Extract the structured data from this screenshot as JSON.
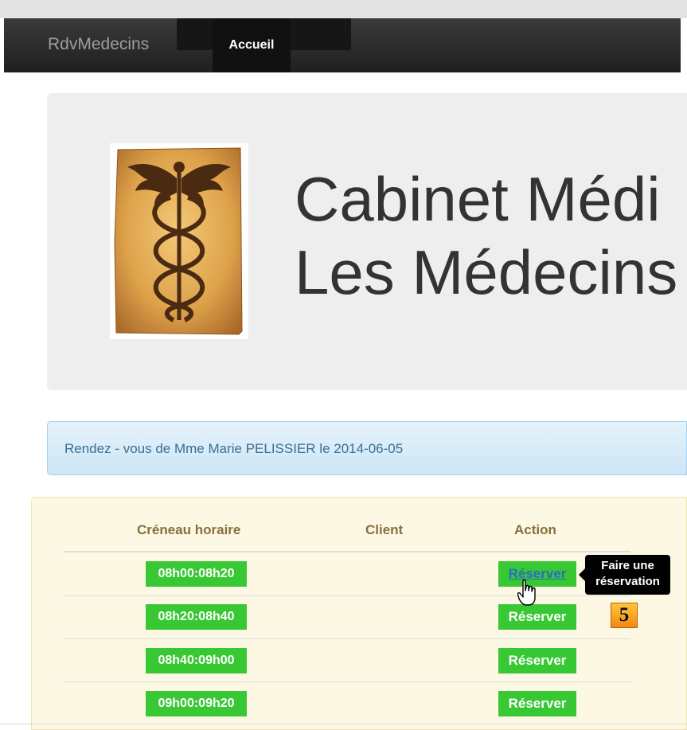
{
  "navbar": {
    "brand": "RdvMedecins",
    "items": [
      {
        "label": "Accueil",
        "active": true
      }
    ]
  },
  "jumbotron": {
    "title_line1": "Cabinet Médi",
    "title_line2": "Les Médecins",
    "logo_icon": "caduceus-icon"
  },
  "alert": {
    "text": "Rendez - vous de Mme Marie PELISSIER le 2014-06-05"
  },
  "table": {
    "headers": [
      "Créneau horaire",
      "Client",
      "Action"
    ],
    "rows": [
      {
        "slot": "08h00:08h20",
        "client": "",
        "action": "Réserver"
      },
      {
        "slot": "08h20:08h40",
        "client": "",
        "action": "Réserver"
      },
      {
        "slot": "08h40:09h00",
        "client": "",
        "action": "Réserver"
      },
      {
        "slot": "09h00:09h20",
        "client": "",
        "action": "Réserver"
      }
    ]
  },
  "tooltip": {
    "line1": "Faire une",
    "line2": "réservation"
  },
  "step_badge": "5",
  "colors": {
    "navbar": "#222222",
    "slot_green": "#37c833",
    "header_text": "#8a6d3b",
    "alert_text": "#3a6f91"
  }
}
